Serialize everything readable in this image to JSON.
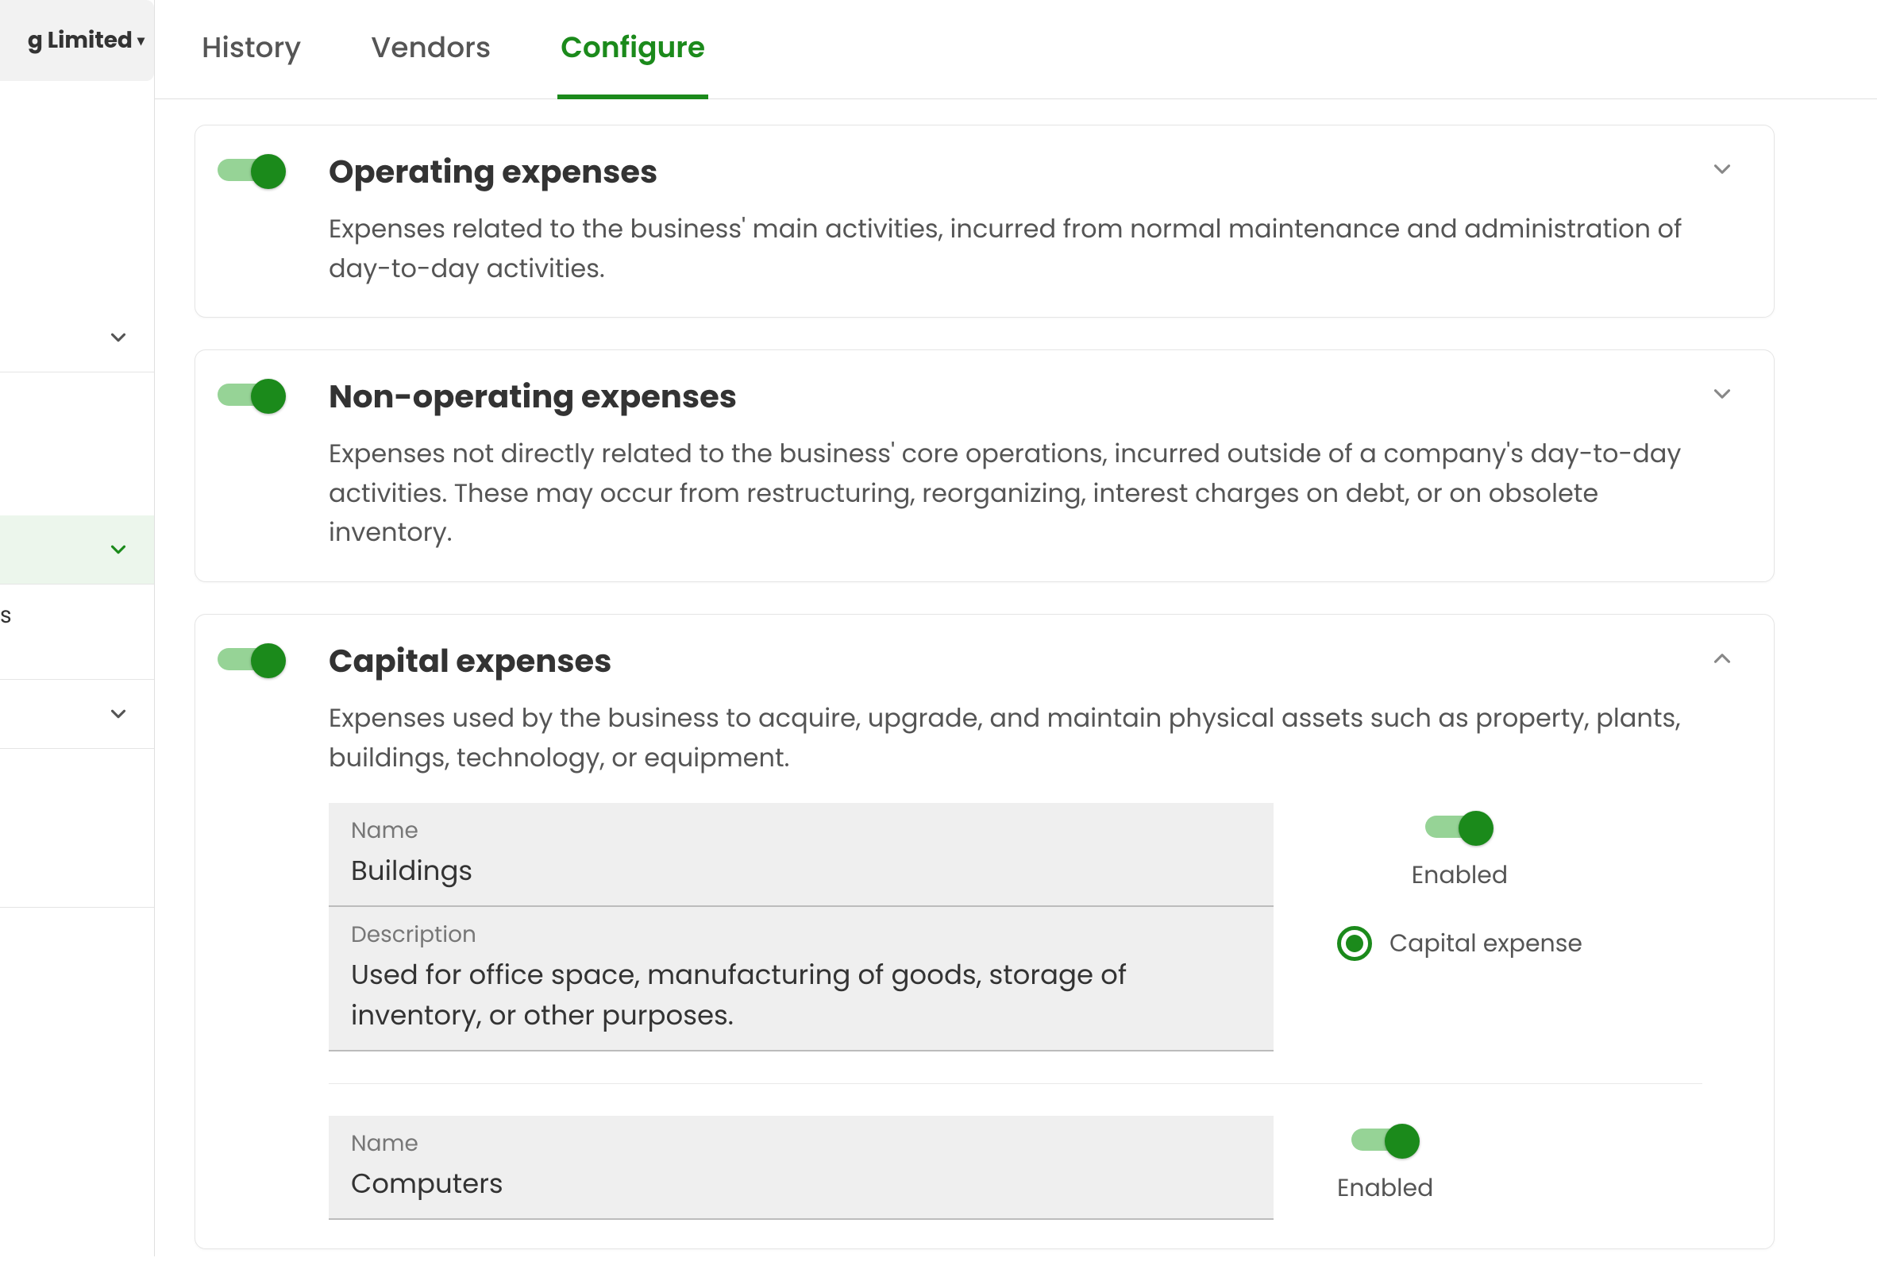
{
  "org": {
    "name_truncated": "g Limited"
  },
  "tabs": {
    "history": "History",
    "vendors": "Vendors",
    "configure": "Configure"
  },
  "categories": [
    {
      "title": "Operating expenses",
      "desc": "Expenses related to the business' main activities, incurred from normal maintenance and administration of day-to-day activities.",
      "expanded": false
    },
    {
      "title": "Non-operating expenses",
      "desc": "Expenses not directly related to the business' core operations, incurred outside of a company's day-to-day activities. These may occur from restructuring, reorganizing, interest charges on debt, or on obsolete inventory.",
      "expanded": false
    },
    {
      "title": "Capital expenses",
      "desc": "Expenses used by the business to acquire, upgrade, and maintain physical assets such as property, plants, buildings, technology, or equipment.",
      "expanded": true
    }
  ],
  "labels": {
    "name": "Name",
    "description": "Description",
    "enabled": "Enabled",
    "capital_expense": "Capital expense"
  },
  "capital_items": [
    {
      "name": "Buildings",
      "description": "Used for office space, manufacturing of goods, storage of inventory, or other purposes."
    },
    {
      "name": "Computers",
      "description": ""
    }
  ],
  "sidebar": {
    "truncated_label": "s"
  }
}
